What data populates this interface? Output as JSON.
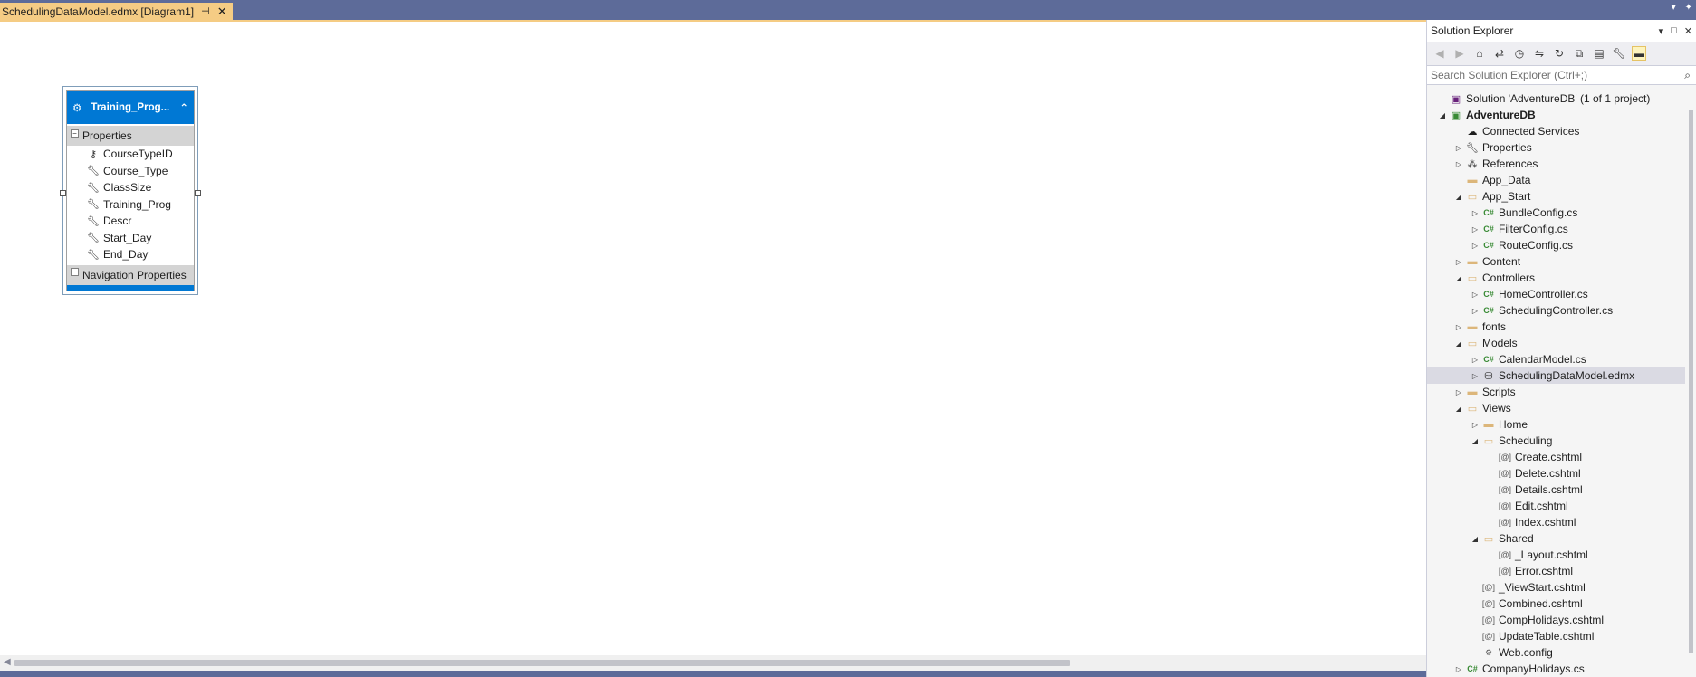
{
  "tab": {
    "title": "SchedulingDataModel.edmx [Diagram1]",
    "pin_icon": "pin-icon",
    "close_icon": "close-icon"
  },
  "entity": {
    "title": "Training_Prog...",
    "properties_header": "Properties",
    "properties": [
      {
        "name": "CourseTypeID",
        "icon": "key-icon"
      },
      {
        "name": "Course_Type",
        "icon": "wrench-icon"
      },
      {
        "name": "ClassSize",
        "icon": "wrench-icon"
      },
      {
        "name": "Training_Prog",
        "icon": "wrench-icon"
      },
      {
        "name": "Descr",
        "icon": "wrench-icon"
      },
      {
        "name": "Start_Day",
        "icon": "wrench-icon"
      },
      {
        "name": "End_Day",
        "icon": "wrench-icon"
      }
    ],
    "navigation_header": "Navigation Properties"
  },
  "solution_explorer": {
    "title": "Solution Explorer",
    "search_placeholder": "Search Solution Explorer (Ctrl+;)",
    "items": [
      {
        "label": "Solution 'AdventureDB' (1 of 1 project)",
        "level": 0,
        "expander": "",
        "icon": "solution-icon"
      },
      {
        "label": "AdventureDB",
        "level": 1,
        "expander": "open",
        "icon": "project-icon",
        "bold": true
      },
      {
        "label": "Connected Services",
        "level": 2,
        "expander": "",
        "icon": "connected-services-icon"
      },
      {
        "label": "Properties",
        "level": 2,
        "expander": "closed",
        "icon": "wrench-icon"
      },
      {
        "label": "References",
        "level": 2,
        "expander": "closed",
        "icon": "references-icon"
      },
      {
        "label": "App_Data",
        "level": 2,
        "expander": "",
        "icon": "folder-icon"
      },
      {
        "label": "App_Start",
        "level": 2,
        "expander": "open",
        "icon": "folder-open-icon"
      },
      {
        "label": "BundleConfig.cs",
        "level": 3,
        "expander": "closed",
        "icon": "csharp-icon"
      },
      {
        "label": "FilterConfig.cs",
        "level": 3,
        "expander": "closed",
        "icon": "csharp-icon"
      },
      {
        "label": "RouteConfig.cs",
        "level": 3,
        "expander": "closed",
        "icon": "csharp-icon"
      },
      {
        "label": "Content",
        "level": 2,
        "expander": "closed",
        "icon": "folder-icon"
      },
      {
        "label": "Controllers",
        "level": 2,
        "expander": "open",
        "icon": "folder-open-icon"
      },
      {
        "label": "HomeController.cs",
        "level": 3,
        "expander": "closed",
        "icon": "csharp-icon"
      },
      {
        "label": "SchedulingController.cs",
        "level": 3,
        "expander": "closed",
        "icon": "csharp-icon"
      },
      {
        "label": "fonts",
        "level": 2,
        "expander": "closed",
        "icon": "folder-icon"
      },
      {
        "label": "Models",
        "level": 2,
        "expander": "open",
        "icon": "folder-open-icon"
      },
      {
        "label": "CalendarModel.cs",
        "level": 3,
        "expander": "closed",
        "icon": "csharp-icon"
      },
      {
        "label": "SchedulingDataModel.edmx",
        "level": 3,
        "expander": "closed",
        "icon": "edmx-icon",
        "selected": true
      },
      {
        "label": "Scripts",
        "level": 2,
        "expander": "closed",
        "icon": "folder-icon"
      },
      {
        "label": "Views",
        "level": 2,
        "expander": "open",
        "icon": "folder-open-icon"
      },
      {
        "label": "Home",
        "level": 3,
        "expander": "closed",
        "icon": "folder-icon"
      },
      {
        "label": "Scheduling",
        "level": 3,
        "expander": "open",
        "icon": "folder-open-icon"
      },
      {
        "label": "Create.cshtml",
        "level": 4,
        "expander": "",
        "icon": "cshtml-icon"
      },
      {
        "label": "Delete.cshtml",
        "level": 4,
        "expander": "",
        "icon": "cshtml-icon"
      },
      {
        "label": "Details.cshtml",
        "level": 4,
        "expander": "",
        "icon": "cshtml-icon"
      },
      {
        "label": "Edit.cshtml",
        "level": 4,
        "expander": "",
        "icon": "cshtml-icon"
      },
      {
        "label": "Index.cshtml",
        "level": 4,
        "expander": "",
        "icon": "cshtml-icon"
      },
      {
        "label": "Shared",
        "level": 3,
        "expander": "open",
        "icon": "folder-open-icon"
      },
      {
        "label": "_Layout.cshtml",
        "level": 4,
        "expander": "",
        "icon": "cshtml-icon"
      },
      {
        "label": "Error.cshtml",
        "level": 4,
        "expander": "",
        "icon": "cshtml-icon"
      },
      {
        "label": "_ViewStart.cshtml",
        "level": 3,
        "expander": "",
        "icon": "cshtml-icon"
      },
      {
        "label": "Combined.cshtml",
        "level": 3,
        "expander": "",
        "icon": "cshtml-icon"
      },
      {
        "label": "CompHolidays.cshtml",
        "level": 3,
        "expander": "",
        "icon": "cshtml-icon"
      },
      {
        "label": "UpdateTable.cshtml",
        "level": 3,
        "expander": "",
        "icon": "cshtml-icon"
      },
      {
        "label": "Web.config",
        "level": 3,
        "expander": "",
        "icon": "config-icon"
      },
      {
        "label": "CompanyHolidays.cs",
        "level": 2,
        "expander": "closed",
        "icon": "csharp-icon"
      }
    ]
  },
  "colors": {
    "accent": "#0078d4",
    "tab": "#f5cc84",
    "chrome": "#5d6b99"
  }
}
